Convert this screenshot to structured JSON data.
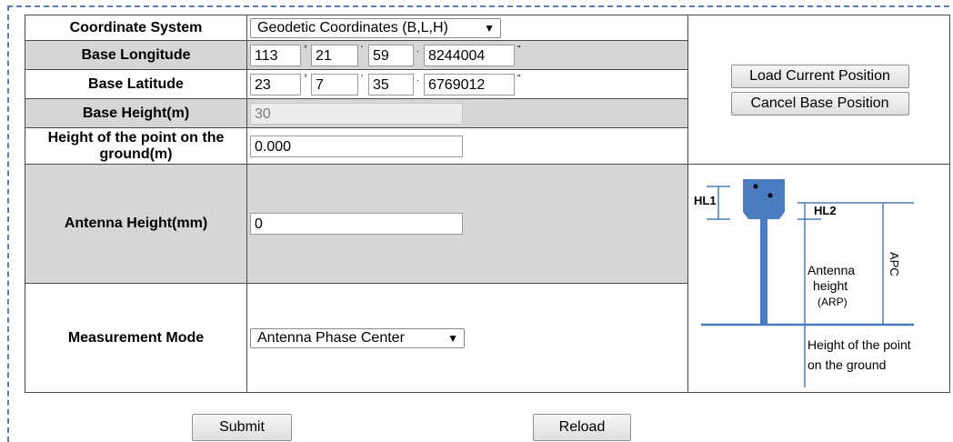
{
  "form": {
    "coordinate_system": {
      "label": "Coordinate System",
      "selected": "Geodetic Coordinates (B,L,H)"
    },
    "base_longitude": {
      "label": "Base Longitude",
      "degrees": "113",
      "minutes": "21",
      "seconds": "59",
      "fraction": "8244004",
      "deg_symbol": "°",
      "min_symbol": "'",
      "dot": ".",
      "sec_symbol": "\""
    },
    "base_latitude": {
      "label": "Base Latitude",
      "degrees": "23",
      "minutes": "7",
      "seconds": "35",
      "fraction": "6769012",
      "deg_symbol": "°",
      "min_symbol": "'",
      "dot": ".",
      "sec_symbol": "\""
    },
    "base_height": {
      "label": "Base Height(m)",
      "value": "30"
    },
    "point_height": {
      "label": "Height of the point on the ground(m)",
      "value": "0.000"
    },
    "antenna_height": {
      "label": "Antenna Height(mm)",
      "value": "0"
    },
    "measurement_mode": {
      "label": "Measurement Mode",
      "selected": "Antenna Phase Center"
    }
  },
  "side_buttons": {
    "load_current": "Load Current Position",
    "cancel_base": "Cancel Base Position"
  },
  "diagram": {
    "hl1": "HL1",
    "hl2": "HL2",
    "apc": "APC",
    "antenna_height_1": "Antenna",
    "antenna_height_2": "height",
    "arp": "(ARP)",
    "point_line_1": "Height of the point",
    "point_line_2": "on the ground",
    "colors": {
      "antenna": "#4a7cc0",
      "lines": "#4a7cc0"
    }
  },
  "actions": {
    "submit": "Submit",
    "reload": "Reload"
  }
}
